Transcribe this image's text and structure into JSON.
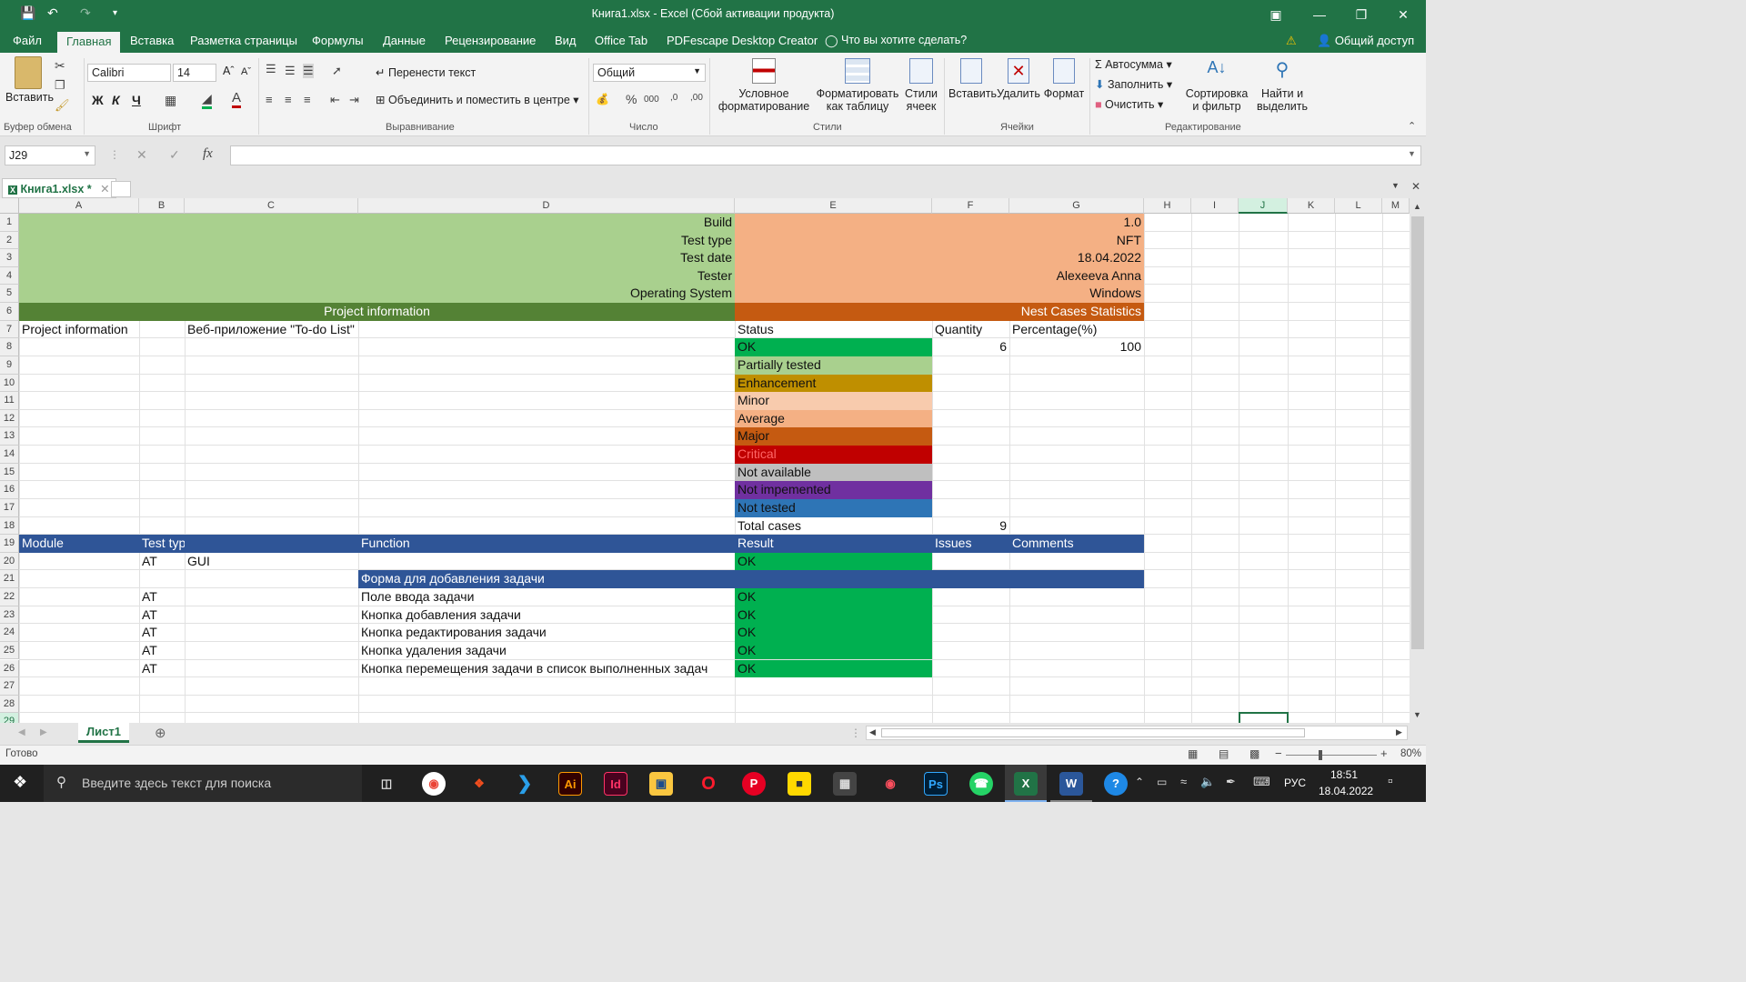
{
  "window": {
    "title": "Книга1.xlsx - Excel (Сбой активации продукта)"
  },
  "menu": {
    "tabs": [
      "Файл",
      "Главная",
      "Вставка",
      "Разметка страницы",
      "Формулы",
      "Данные",
      "Рецензирование",
      "Вид",
      "Office Tab",
      "PDFescape Desktop Creator"
    ],
    "active": "Главная",
    "tell_me": "Что вы хотите сделать?",
    "share": "Общий доступ"
  },
  "ribbon": {
    "clipboard": {
      "paste": "Вставить",
      "label": "Буфер обмена"
    },
    "font": {
      "name": "Calibri",
      "size": "14",
      "bold": "Ж",
      "italic": "К",
      "underline": "Ч",
      "label": "Шрифт"
    },
    "alignment": {
      "wrap": "Перенести текст",
      "merge": "Объединить и поместить в центре",
      "label": "Выравнивание"
    },
    "number": {
      "format": "Общий",
      "label": "Число"
    },
    "styles": {
      "conditional": "Условное",
      "conditional2": "форматирование",
      "table": "Форматировать",
      "table2": "как таблицу",
      "cell": "Стили",
      "cell2": "ячеек",
      "label": "Стили"
    },
    "cells": {
      "insert": "Вставить",
      "delete": "Удалить",
      "format": "Формат",
      "label": "Ячейки"
    },
    "editing": {
      "autosum": "Автосумма",
      "fill": "Заполнить",
      "clear": "Очистить",
      "sort": "Сортировка",
      "sort2": "и фильтр",
      "find": "Найти и",
      "find2": "выделить",
      "label": "Редактирование"
    }
  },
  "formula_bar": {
    "name_box": "J29",
    "formula": ""
  },
  "workbook_tab": {
    "name": "Книга1.xlsx *"
  },
  "columns": [
    "A",
    "B",
    "C",
    "D",
    "E",
    "F",
    "G",
    "H",
    "I",
    "J",
    "K",
    "L",
    "M"
  ],
  "rows": [
    "1",
    "2",
    "3",
    "4",
    "5",
    "6",
    "7",
    "8",
    "9",
    "10",
    "11",
    "12",
    "13",
    "14",
    "15",
    "16",
    "17",
    "18",
    "19",
    "20",
    "21",
    "22",
    "23",
    "24",
    "25",
    "26",
    "27",
    "28",
    "29"
  ],
  "sheet": {
    "info_labels": [
      "Build",
      "Test type",
      "Test date",
      "Tester",
      "Operating System"
    ],
    "info_values": [
      "1.0",
      "NFT",
      "18.04.2022",
      "Alexeeva Anna",
      "Windows"
    ],
    "project_header": "Project information",
    "stats_header": "Nest Cases Statistics",
    "project_label": "Project information",
    "project_value": "Веб-приложение \"To-do List\"",
    "status_header": "Status",
    "quantity_header": "Quantity",
    "percentage_header": "Percentage(%)",
    "statuses": [
      "OK",
      "Partially tested",
      "Enhancement",
      "Minor",
      "Average",
      "Major",
      "Critical",
      "Not available",
      "Not impemented",
      "Not tested"
    ],
    "status_colors": [
      "#00b050",
      "#a9d08e",
      "#bf8f00",
      "#f8cbad",
      "#f4b084",
      "#c55a11",
      "#c00000",
      "#bfbfbf",
      "#7030a0",
      "#2e75b6"
    ],
    "ok_quantity": "6",
    "ok_percentage": "100",
    "total_label": "Total cases",
    "total_value": "9",
    "table_headers": [
      "Module",
      "Test type",
      "Function",
      "Result",
      "Issues",
      "Comments"
    ],
    "row20": {
      "type": "AT",
      "sub": "GUI",
      "result": "OK"
    },
    "section_title": "Форма для добавления задачи",
    "cases": [
      {
        "type": "AT",
        "function": "Поле ввода задачи",
        "result": "OK"
      },
      {
        "type": "AT",
        "function": "Кнопка добавления задачи",
        "result": "OK"
      },
      {
        "type": "AT",
        "function": "Кнопка редактирования задачи",
        "result": "OK"
      },
      {
        "type": "AT",
        "function": "Кнопка удаления задачи",
        "result": "OK"
      },
      {
        "type": "AT",
        "function": "Кнопка перемещения задачи в список выполненных задач",
        "result": "OK"
      }
    ]
  },
  "sheet_tab": "Лист1",
  "status_bar": {
    "ready": "Готово",
    "zoom": "80%"
  },
  "taskbar": {
    "search": "Введите здесь текст для поиска",
    "lang": "РУС",
    "time": "18:51",
    "date": "18.04.2022"
  },
  "colors": {
    "excel_green": "#217346",
    "green_light": "#a9d08e",
    "green_dark": "#548235",
    "orange_light": "#f4b084",
    "orange_dark": "#c55a11",
    "blue_header": "#2f5597"
  }
}
